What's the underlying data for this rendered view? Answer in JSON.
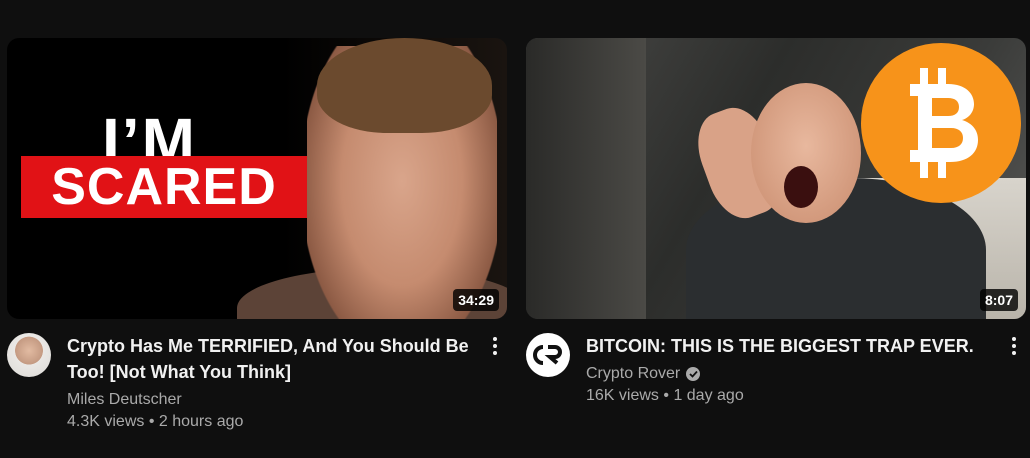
{
  "videos": [
    {
      "thumb_text_line1": "I’M",
      "thumb_text_line2": "SCARED",
      "duration": "34:29",
      "title": "Crypto Has Me TERRIFIED, And You Should Be Too! [Not What You Think]",
      "channel": "Miles Deutscher",
      "views": "4.3K views",
      "age": "2 hours ago",
      "verified": false,
      "icons": {
        "menu": "more-vert-icon"
      }
    },
    {
      "duration": "8:07",
      "title": "BITCOIN: THIS IS THE BIGGEST TRAP EVER.",
      "channel": "Crypto Rover",
      "views": "16K views",
      "age": "1 day ago",
      "verified": true,
      "icons": {
        "menu": "more-vert-icon",
        "badge": "verified-check-icon",
        "logo": "bitcoin-logo-icon"
      }
    }
  ],
  "separator": "•",
  "colors": {
    "background": "#0f0f0f",
    "accent_red": "#e11216",
    "bitcoin_orange": "#f7931a",
    "secondary_text": "#aaaaaa"
  }
}
